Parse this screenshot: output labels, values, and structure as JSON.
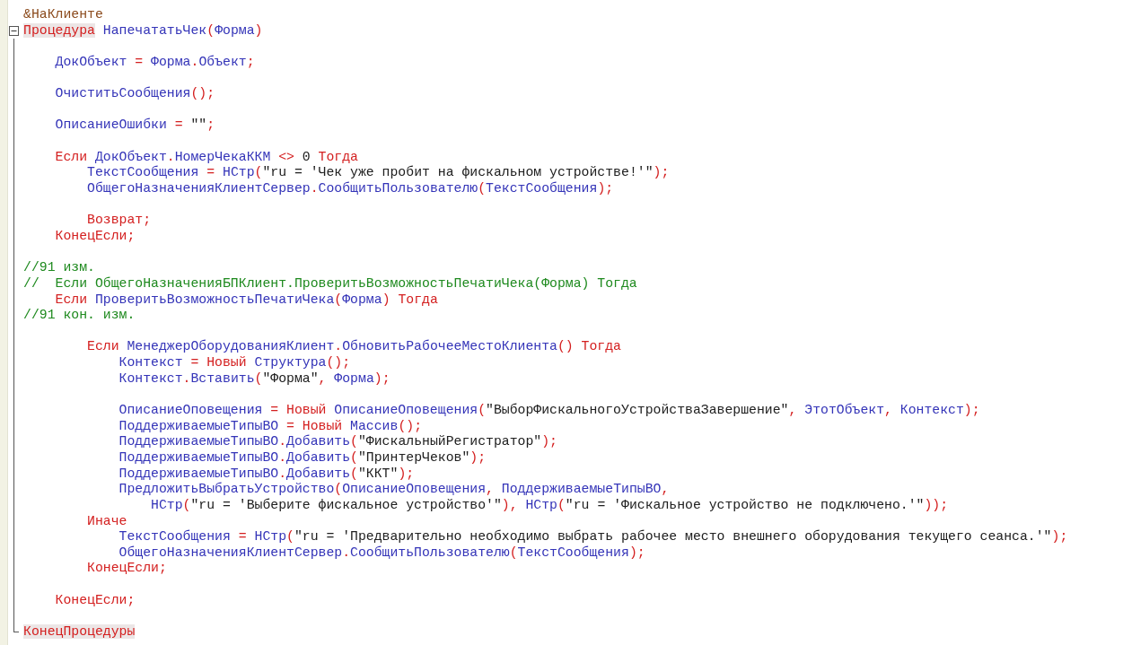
{
  "editor": {
    "blocks": [
      {
        "lines": [
          {
            "tokens": [
              {
                "text": "&НаКлиенте",
                "kind": "pre"
              }
            ]
          },
          {
            "fold": {
              "expanded": true
            },
            "tokens": [
              {
                "text": "Процедура",
                "kind": "block"
              },
              {
                "text": " НапечататьЧек",
                "kind": "id"
              },
              {
                "text": "(",
                "kind": "op"
              },
              {
                "text": "Форма",
                "kind": "id"
              },
              {
                "text": ")",
                "kind": "op"
              }
            ]
          }
        ]
      },
      {
        "lines": [
          {
            "tokens": [
              {
                "text": "    ДокОбъект",
                "kind": "id"
              },
              {
                "text": " = ",
                "kind": "op"
              },
              {
                "text": "Форма",
                "kind": "id"
              },
              {
                "text": ".",
                "kind": "op"
              },
              {
                "text": "Объект",
                "kind": "id"
              },
              {
                "text": ";",
                "kind": "op"
              }
            ]
          }
        ]
      },
      {
        "lines": [
          {
            "tokens": [
              {
                "text": "    ОчиститьСообщения",
                "kind": "id"
              },
              {
                "text": "();",
                "kind": "op"
              }
            ]
          }
        ]
      },
      {
        "lines": [
          {
            "tokens": [
              {
                "text": "    ОписаниеОшибки",
                "kind": "id"
              },
              {
                "text": " = ",
                "kind": "op"
              },
              {
                "text": "\"\"",
                "kind": "str"
              },
              {
                "text": ";",
                "kind": "op"
              }
            ]
          }
        ]
      },
      {
        "lines": [
          {
            "tokens": [
              {
                "text": "    Если",
                "kind": "kw"
              },
              {
                "text": " ДокОбъект",
                "kind": "id"
              },
              {
                "text": ".",
                "kind": "op"
              },
              {
                "text": "НомерЧекаККМ",
                "kind": "id"
              },
              {
                "text": " <> ",
                "kind": "op"
              },
              {
                "text": "0",
                "kind": "num"
              },
              {
                "text": " Тогда",
                "kind": "kw"
              }
            ]
          },
          {
            "tokens": [
              {
                "text": "        ТекстСообщения",
                "kind": "id"
              },
              {
                "text": " = ",
                "kind": "op"
              },
              {
                "text": "НСтр",
                "kind": "id"
              },
              {
                "text": "(",
                "kind": "op"
              },
              {
                "text": "\"ru = 'Чек уже пробит на фискальном устройстве!'\"",
                "kind": "str"
              },
              {
                "text": ");",
                "kind": "op"
              }
            ]
          },
          {
            "tokens": [
              {
                "text": "        ОбщегоНазначенияКлиентСервер",
                "kind": "id"
              },
              {
                "text": ".",
                "kind": "op"
              },
              {
                "text": "СообщитьПользователю",
                "kind": "id"
              },
              {
                "text": "(",
                "kind": "op"
              },
              {
                "text": "ТекстСообщения",
                "kind": "id"
              },
              {
                "text": ");",
                "kind": "op"
              }
            ]
          }
        ]
      },
      {
        "lines": [
          {
            "tokens": [
              {
                "text": "        Возврат;",
                "kind": "kw"
              }
            ]
          },
          {
            "tokens": [
              {
                "text": "    КонецЕсли;",
                "kind": "kw"
              }
            ]
          }
        ]
      },
      {
        "lines": [
          {
            "tokens": [
              {
                "text": "//91 изм.",
                "kind": "comment"
              }
            ]
          },
          {
            "tokens": [
              {
                "text": "//  Если ОбщегоНазначенияБПКлиент.ПроверитьВозможностьПечатиЧека(Форма) Тогда",
                "kind": "comment"
              }
            ]
          },
          {
            "tokens": [
              {
                "text": "    Если",
                "kind": "kw"
              },
              {
                "text": " ПроверитьВозможностьПечатиЧека",
                "kind": "id"
              },
              {
                "text": "(",
                "kind": "op"
              },
              {
                "text": "Форма",
                "kind": "id"
              },
              {
                "text": ")",
                "kind": "op"
              },
              {
                "text": " Тогда",
                "kind": "kw"
              }
            ]
          },
          {
            "tokens": [
              {
                "text": "//91 кон. изм.",
                "kind": "comment"
              }
            ]
          }
        ]
      },
      {
        "lines": [
          {
            "tokens": [
              {
                "text": "        Если",
                "kind": "kw"
              },
              {
                "text": " МенеджерОборудованияКлиент",
                "kind": "id"
              },
              {
                "text": ".",
                "kind": "op"
              },
              {
                "text": "ОбновитьРабочееМестоКлиента",
                "kind": "id"
              },
              {
                "text": "()",
                "kind": "op"
              },
              {
                "text": " Тогда",
                "kind": "kw"
              }
            ]
          },
          {
            "tokens": [
              {
                "text": "            Контекст",
                "kind": "id"
              },
              {
                "text": " = ",
                "kind": "op"
              },
              {
                "text": "Новый",
                "kind": "kw"
              },
              {
                "text": " Структура",
                "kind": "id"
              },
              {
                "text": "();",
                "kind": "op"
              }
            ]
          },
          {
            "tokens": [
              {
                "text": "            Контекст",
                "kind": "id"
              },
              {
                "text": ".",
                "kind": "op"
              },
              {
                "text": "Вставить",
                "kind": "id"
              },
              {
                "text": "(",
                "kind": "op"
              },
              {
                "text": "\"Форма\"",
                "kind": "str"
              },
              {
                "text": ", ",
                "kind": "op"
              },
              {
                "text": "Форма",
                "kind": "id"
              },
              {
                "text": ");",
                "kind": "op"
              }
            ]
          }
        ]
      },
      {
        "lines": [
          {
            "tokens": [
              {
                "text": "            ОписаниеОповещения",
                "kind": "id"
              },
              {
                "text": " = ",
                "kind": "op"
              },
              {
                "text": "Новый",
                "kind": "kw"
              },
              {
                "text": " ОписаниеОповещения",
                "kind": "id"
              },
              {
                "text": "(",
                "kind": "op"
              },
              {
                "text": "\"ВыборФискальногоУстройстваЗавершение\"",
                "kind": "str"
              },
              {
                "text": ", ",
                "kind": "op"
              },
              {
                "text": "ЭтотОбъект",
                "kind": "id"
              },
              {
                "text": ", ",
                "kind": "op"
              },
              {
                "text": "Контекст",
                "kind": "id"
              },
              {
                "text": ");",
                "kind": "op"
              }
            ]
          },
          {
            "tokens": [
              {
                "text": "            ПоддерживаемыеТипыВО",
                "kind": "id"
              },
              {
                "text": " = ",
                "kind": "op"
              },
              {
                "text": "Новый",
                "kind": "kw"
              },
              {
                "text": " Массив",
                "kind": "id"
              },
              {
                "text": "();",
                "kind": "op"
              }
            ]
          },
          {
            "tokens": [
              {
                "text": "            ПоддерживаемыеТипыВО",
                "kind": "id"
              },
              {
                "text": ".",
                "kind": "op"
              },
              {
                "text": "Добавить",
                "kind": "id"
              },
              {
                "text": "(",
                "kind": "op"
              },
              {
                "text": "\"ФискальныйРегистратор\"",
                "kind": "str"
              },
              {
                "text": ");",
                "kind": "op"
              }
            ]
          },
          {
            "tokens": [
              {
                "text": "            ПоддерживаемыеТипыВО",
                "kind": "id"
              },
              {
                "text": ".",
                "kind": "op"
              },
              {
                "text": "Добавить",
                "kind": "id"
              },
              {
                "text": "(",
                "kind": "op"
              },
              {
                "text": "\"ПринтерЧеков\"",
                "kind": "str"
              },
              {
                "text": ");",
                "kind": "op"
              }
            ]
          },
          {
            "tokens": [
              {
                "text": "            ПоддерживаемыеТипыВО",
                "kind": "id"
              },
              {
                "text": ".",
                "kind": "op"
              },
              {
                "text": "Добавить",
                "kind": "id"
              },
              {
                "text": "(",
                "kind": "op"
              },
              {
                "text": "\"ККТ\"",
                "kind": "str"
              },
              {
                "text": ");",
                "kind": "op"
              }
            ]
          },
          {
            "tokens": [
              {
                "text": "            ПредложитьВыбратьУстройство",
                "kind": "id"
              },
              {
                "text": "(",
                "kind": "op"
              },
              {
                "text": "ОписаниеОповещения",
                "kind": "id"
              },
              {
                "text": ", ",
                "kind": "op"
              },
              {
                "text": "ПоддерживаемыеТипыВО",
                "kind": "id"
              },
              {
                "text": ",",
                "kind": "op"
              }
            ]
          },
          {
            "tokens": [
              {
                "text": "                НСтр",
                "kind": "id"
              },
              {
                "text": "(",
                "kind": "op"
              },
              {
                "text": "\"ru = 'Выберите фискальное устройство'\"",
                "kind": "str"
              },
              {
                "text": "), ",
                "kind": "op"
              },
              {
                "text": "НСтр",
                "kind": "id"
              },
              {
                "text": "(",
                "kind": "op"
              },
              {
                "text": "\"ru = 'Фискальное устройство не подключено.'\"",
                "kind": "str"
              },
              {
                "text": "));",
                "kind": "op"
              }
            ]
          },
          {
            "tokens": [
              {
                "text": "        Иначе",
                "kind": "kw"
              }
            ]
          },
          {
            "tokens": [
              {
                "text": "            ТекстСообщения",
                "kind": "id"
              },
              {
                "text": " = ",
                "kind": "op"
              },
              {
                "text": "НСтр",
                "kind": "id"
              },
              {
                "text": "(",
                "kind": "op"
              },
              {
                "text": "\"ru = 'Предварительно необходимо выбрать рабочее место внешнего оборудования текущего сеанса.'\"",
                "kind": "str"
              },
              {
                "text": ");",
                "kind": "op"
              }
            ]
          },
          {
            "tokens": [
              {
                "text": "            ОбщегоНазначенияКлиентСервер",
                "kind": "id"
              },
              {
                "text": ".",
                "kind": "op"
              },
              {
                "text": "СообщитьПользователю",
                "kind": "id"
              },
              {
                "text": "(",
                "kind": "op"
              },
              {
                "text": "ТекстСообщения",
                "kind": "id"
              },
              {
                "text": ");",
                "kind": "op"
              }
            ]
          },
          {
            "tokens": [
              {
                "text": "        КонецЕсли;",
                "kind": "kw"
              }
            ]
          }
        ]
      },
      {
        "lines": [
          {
            "tokens": [
              {
                "text": "    КонецЕсли;",
                "kind": "kw"
              }
            ]
          }
        ]
      },
      {
        "lines": [
          {
            "tokens": [
              {
                "text": "КонецПроцедуры",
                "kind": "block"
              }
            ]
          }
        ]
      }
    ]
  }
}
